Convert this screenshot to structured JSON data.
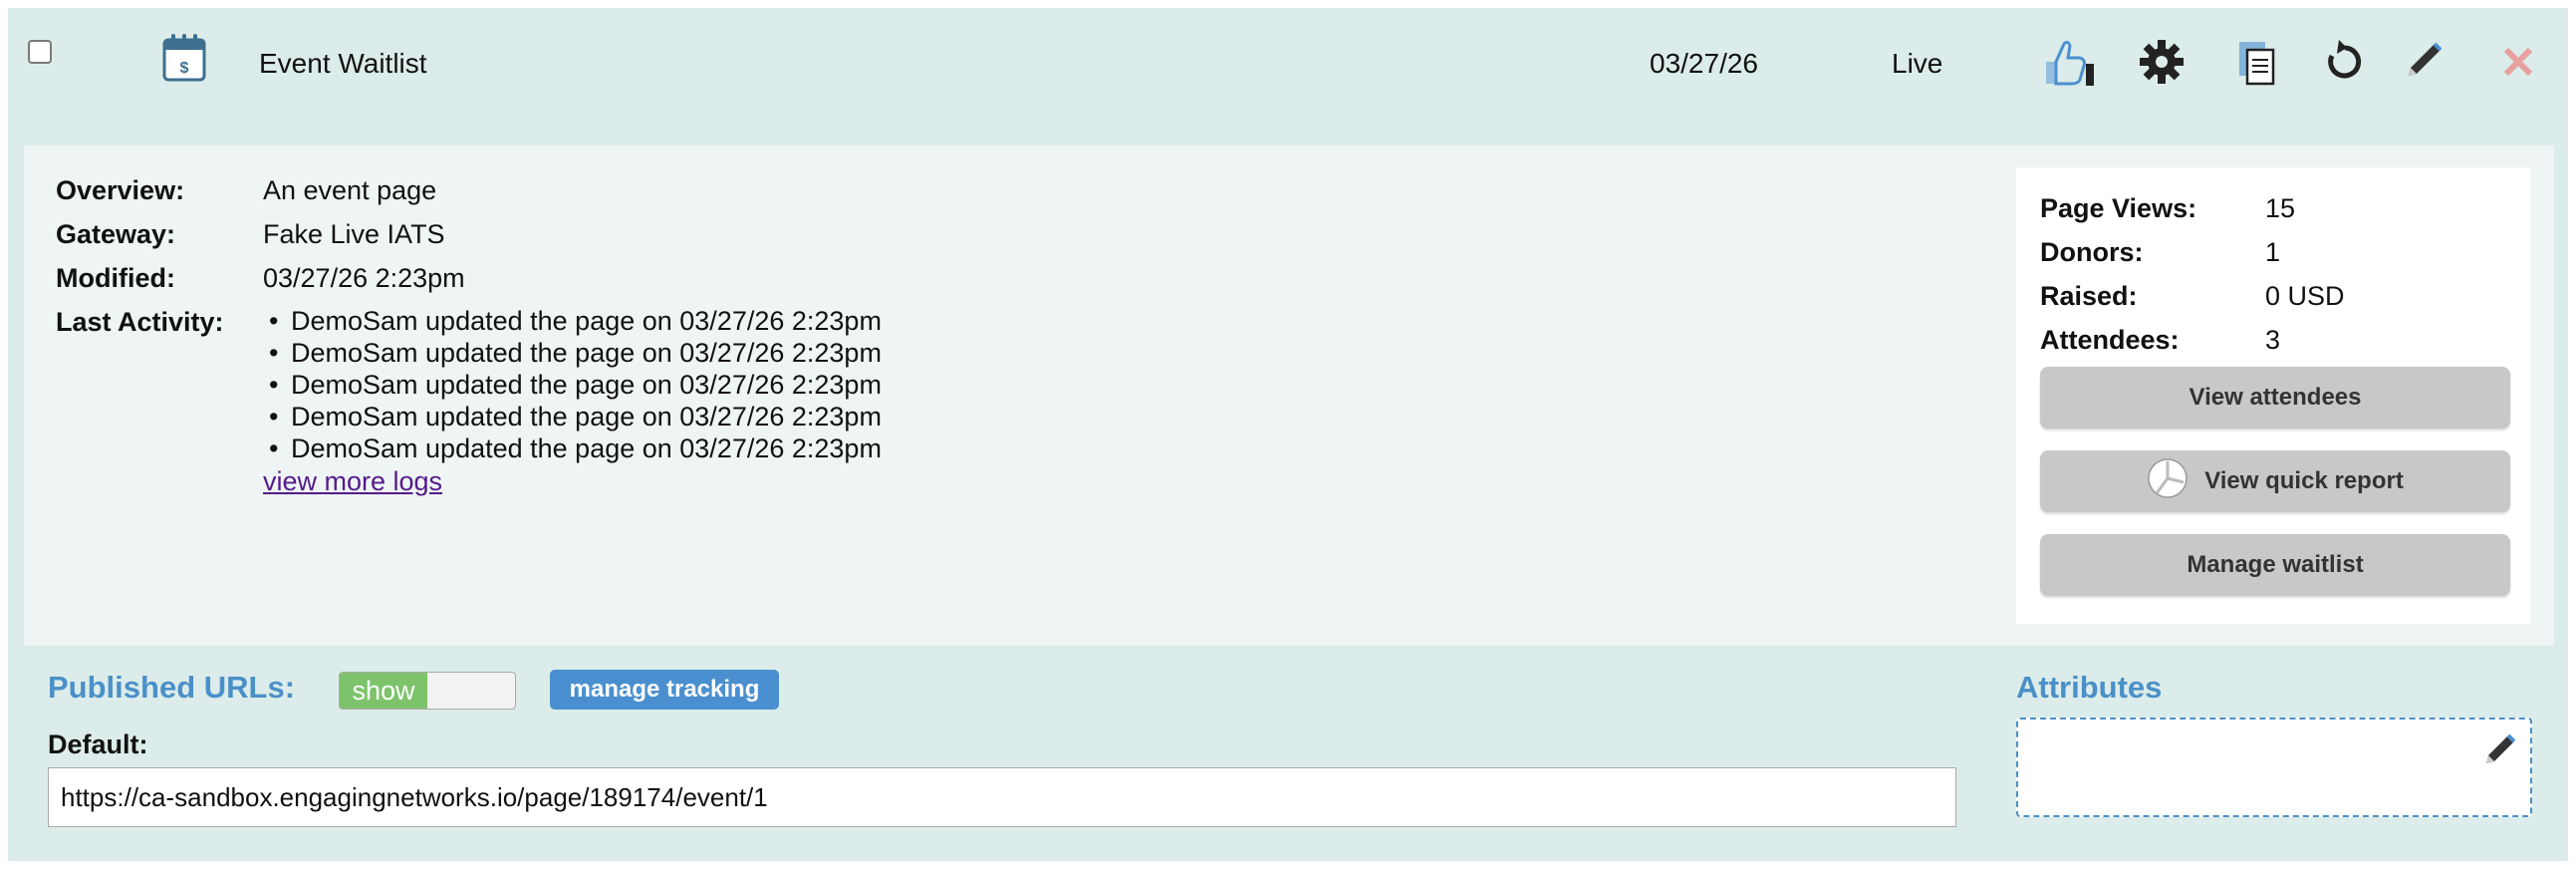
{
  "row": {
    "title": "Event Waitlist",
    "date": "03/27/26",
    "status": "Live",
    "icons": [
      "calendar-dollar-icon",
      "thumbs-up-icon",
      "gear-icon",
      "copy-icon",
      "refresh-icon",
      "pencil-icon",
      "close-icon"
    ],
    "colors": {
      "thumb": "#4a90d0",
      "close": "#e8a0a0"
    }
  },
  "details": {
    "overview_label": "Overview:",
    "overview_value": "An event page",
    "gateway_label": "Gateway:",
    "gateway_value": "Fake Live IATS",
    "modified_label": "Modified:",
    "modified_value": "03/27/26 2:23pm",
    "activity_label": "Last Activity:",
    "logs": [
      "DemoSam updated the page on 03/27/26 2:23pm",
      "DemoSam updated the page on 03/27/26 2:23pm",
      "DemoSam updated the page on 03/27/26 2:23pm",
      "DemoSam updated the page on 03/27/26 2:23pm",
      "DemoSam updated the page on 03/27/26 2:23pm"
    ],
    "more_logs": "view more logs"
  },
  "stats": {
    "page_views_label": "Page Views:",
    "page_views": "15",
    "donors_label": "Donors:",
    "donors": "1",
    "raised_label": "Raised:",
    "raised": "0 USD",
    "attendees_label": "Attendees:",
    "attendees": "3",
    "view_attendees": "View attendees",
    "quick_report": "View quick report",
    "manage_waitlist": "Manage waitlist"
  },
  "published": {
    "title": "Published URLs:",
    "toggle_label": "show",
    "tracking_button": "manage tracking",
    "default_label": "Default:",
    "default_url": "https://ca-sandbox.engagingnetworks.io/page/189174/event/1"
  },
  "attributes": {
    "title": "Attributes"
  }
}
